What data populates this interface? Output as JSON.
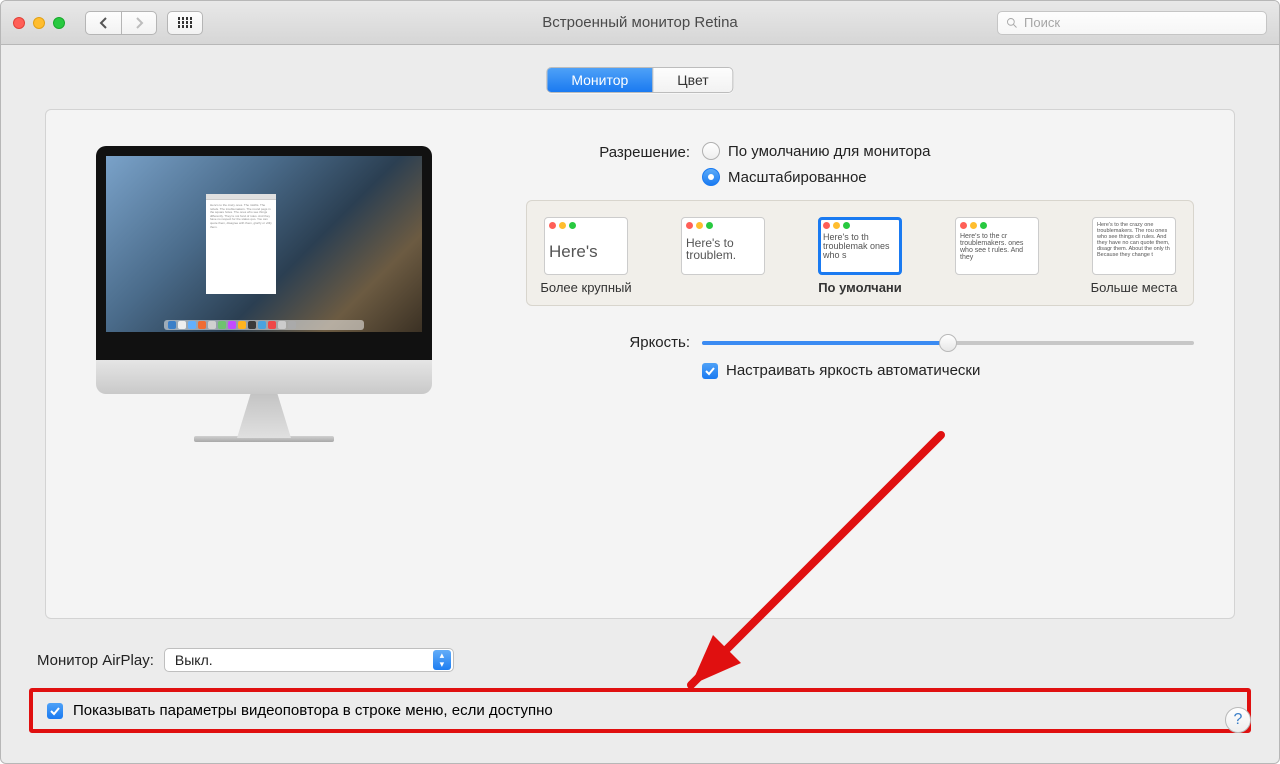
{
  "window": {
    "title": "Встроенный монитор Retina",
    "search_placeholder": "Поиск"
  },
  "tabs": {
    "display": "Монитор",
    "color": "Цвет"
  },
  "resolution": {
    "label": "Разрешение:",
    "opt_default": "По умолчанию для монитора",
    "opt_scaled": "Масштабированное",
    "thumbs": [
      {
        "text": "Here's",
        "caption": "Более крупный"
      },
      {
        "text": "Here's to troublem.",
        "caption": ""
      },
      {
        "text": "Here's to th troublemak ones who s",
        "caption": "По умолчани"
      },
      {
        "text": "Here's to the cr troublemakers. ones who see t rules. And they",
        "caption": ""
      },
      {
        "text": "Here's to the crazy one troublemakers. The rou ones who see things cli rules. And they have no can quote them, disagr them. About the only th Because they change t",
        "caption": "Больше места"
      }
    ]
  },
  "brightness": {
    "label": "Яркость:",
    "value_pct": 50,
    "auto_label": "Настраивать яркость автоматически"
  },
  "airplay": {
    "label": "Монитор AirPlay:",
    "value": "Выкл."
  },
  "mirror": {
    "label": "Показывать параметры видеоповтора в строке меню, если доступно"
  },
  "help": "?",
  "annotation": {
    "arrow": true
  }
}
